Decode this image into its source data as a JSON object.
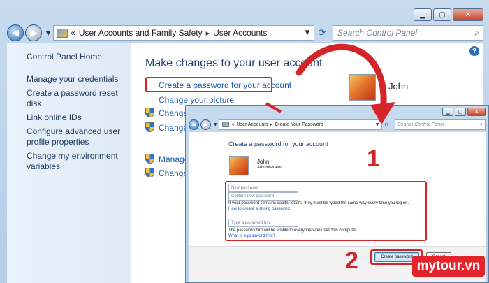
{
  "main_window": {
    "breadcrumb": [
      "User Accounts and Family Safety",
      "User Accounts"
    ],
    "breadcrumb_prefix": "«",
    "search_placeholder": "Search Control Panel",
    "left_pane": {
      "home": "Control Panel Home",
      "items": [
        "Manage your credentials",
        "Create a password reset disk",
        "Link online IDs",
        "Configure advanced user profile properties",
        "Change my environment variables"
      ]
    },
    "heading": "Make changes to your user account",
    "links": {
      "create_password": "Create a password for your account",
      "change_picture": "Change your picture",
      "change_1": "Change",
      "change_2": "Change",
      "manage": "Manage",
      "change_3": "Change"
    },
    "user_name": "John"
  },
  "dialog_window": {
    "breadcrumb": [
      "User Accounts",
      "Create Your Password"
    ],
    "breadcrumb_prefix": "«",
    "search_placeholder": "Search Control Panel",
    "heading": "Create a password for your account",
    "user_name": "John",
    "user_role": "Administrator",
    "new_password_placeholder": "New password",
    "confirm_password_placeholder": "Confirm new password",
    "caps_note": "If your password contains capital letters, they must be typed the same way every time you log on.",
    "strong_password_link": "How to create a strong password",
    "hint_placeholder": "Type a password hint",
    "hint_note": "The password hint will be visible to everyone who uses this computer.",
    "hint_link": "What is a password hint?",
    "create_button": "Create password",
    "cancel_button": "Cancel"
  },
  "annotations": {
    "step_1": "1",
    "step_2": "2",
    "color": "#d4242a"
  },
  "watermark": "mytour.vn",
  "colors": {
    "link": "#1c5bb0",
    "heading": "#1e3f78",
    "chrome": "#c7dbef",
    "logo_bg": "#e3242b"
  }
}
